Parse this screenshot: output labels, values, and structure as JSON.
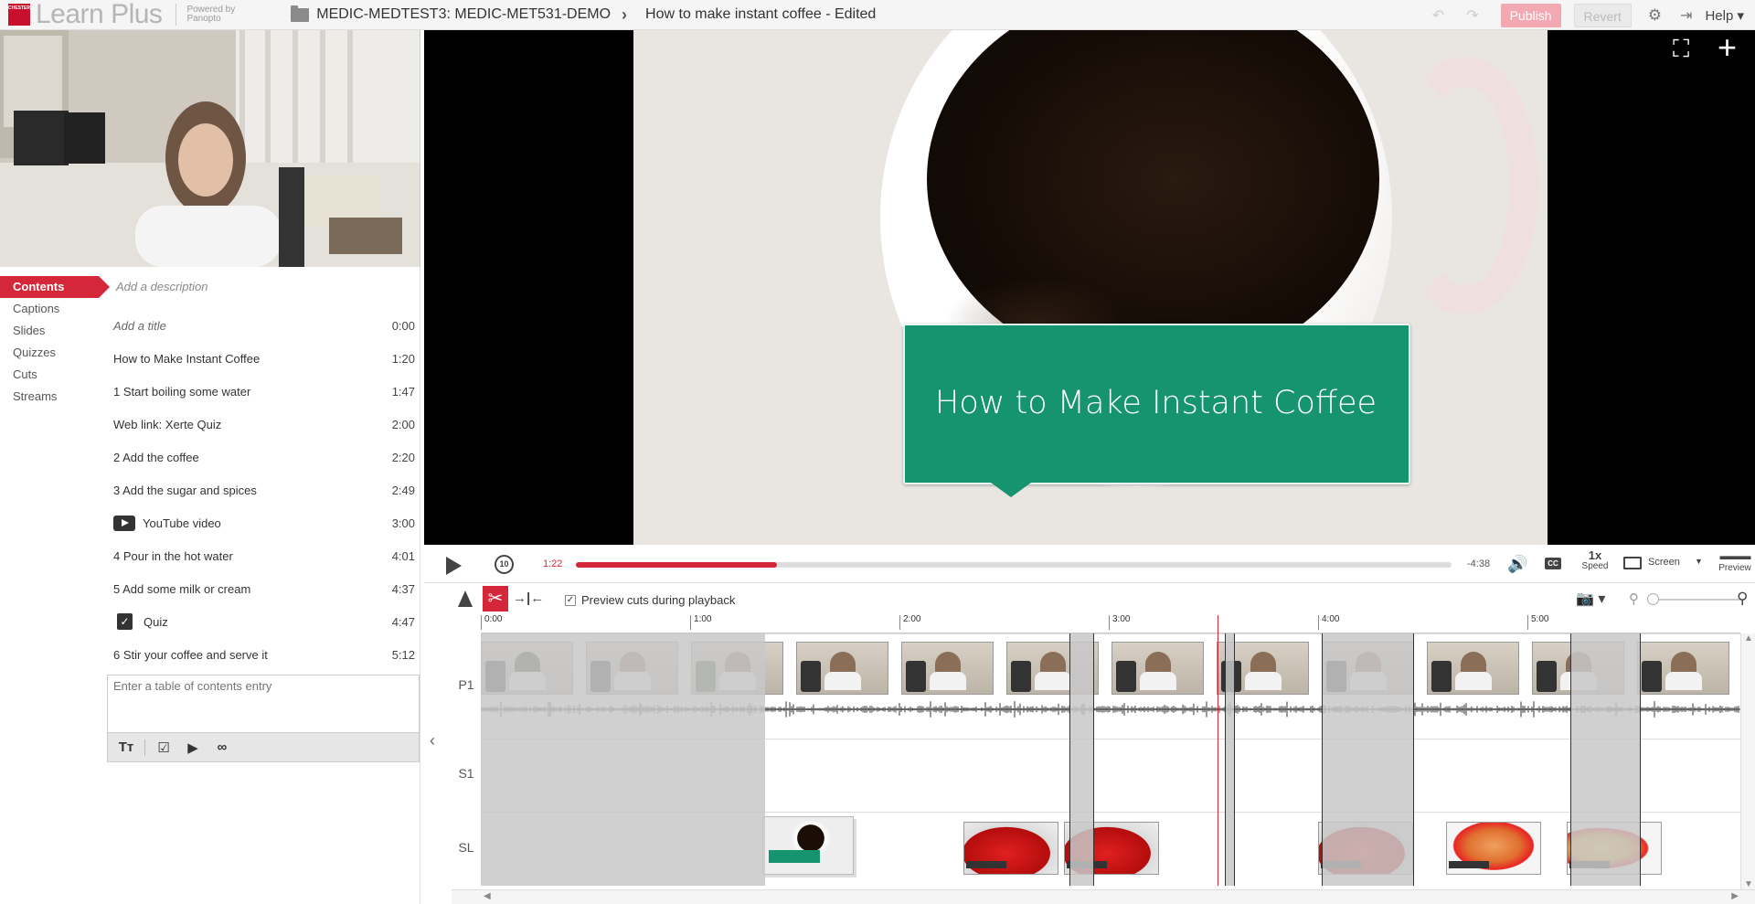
{
  "header": {
    "logo_text": "CHESTER",
    "brand": "Learn Plus",
    "powered": "Powered by",
    "powered_by": "Panopto",
    "folder": "MEDIC-MEDTEST3: MEDIC-MET531-DEMO",
    "session_title": "How to make instant coffee - Edited",
    "publish_label": "Publish",
    "revert_label": "Revert",
    "help_label": "Help",
    "accent_color": "#d5273a"
  },
  "tabs": [
    "Contents",
    "Captions",
    "Slides",
    "Quizzes",
    "Cuts",
    "Streams"
  ],
  "active_tab": "Contents",
  "contents": {
    "description_placeholder": "Add a description",
    "entries": [
      {
        "title": "Add a title",
        "time": "0:00",
        "type": "placeholder"
      },
      {
        "title": "How to Make Instant Coffee",
        "time": "1:20",
        "type": "text"
      },
      {
        "title": "1 Start boiling some water",
        "time": "1:47",
        "type": "text"
      },
      {
        "title": "Web link: Xerte Quiz",
        "time": "2:00",
        "type": "text"
      },
      {
        "title": "2 Add the coffee",
        "time": "2:20",
        "type": "text"
      },
      {
        "title": "3 Add the sugar and spices",
        "time": "2:49",
        "type": "text"
      },
      {
        "title": "YouTube video",
        "time": "3:00",
        "type": "youtube"
      },
      {
        "title": "4 Pour in the hot water",
        "time": "4:01",
        "type": "text"
      },
      {
        "title": "5 Add some milk or cream",
        "time": "4:37",
        "type": "text"
      },
      {
        "title": "Quiz",
        "time": "4:47",
        "type": "quiz"
      },
      {
        "title": "6 Stir your coffee and serve it",
        "time": "5:12",
        "type": "text"
      }
    ],
    "entry_placeholder": "Enter a table of contents entry"
  },
  "video": {
    "slide_title": "How to Make Instant Coffee"
  },
  "player": {
    "current_time": "1:22",
    "remaining_time": "-4:38",
    "progress_fraction": 0.23,
    "speed_value": "1x",
    "speed_label": "Speed",
    "screen_label": "Screen",
    "preview_label": "Preview",
    "cc_label": "CC",
    "rewind_label": "10"
  },
  "edit": {
    "preview_cuts_label": "Preview cuts during playback",
    "preview_cuts_checked": true
  },
  "timeline": {
    "ticks": [
      "0:00",
      "1:00",
      "2:00",
      "3:00",
      "4:00",
      "5:00"
    ],
    "tracks": [
      "P1",
      "S1",
      "SL"
    ]
  }
}
